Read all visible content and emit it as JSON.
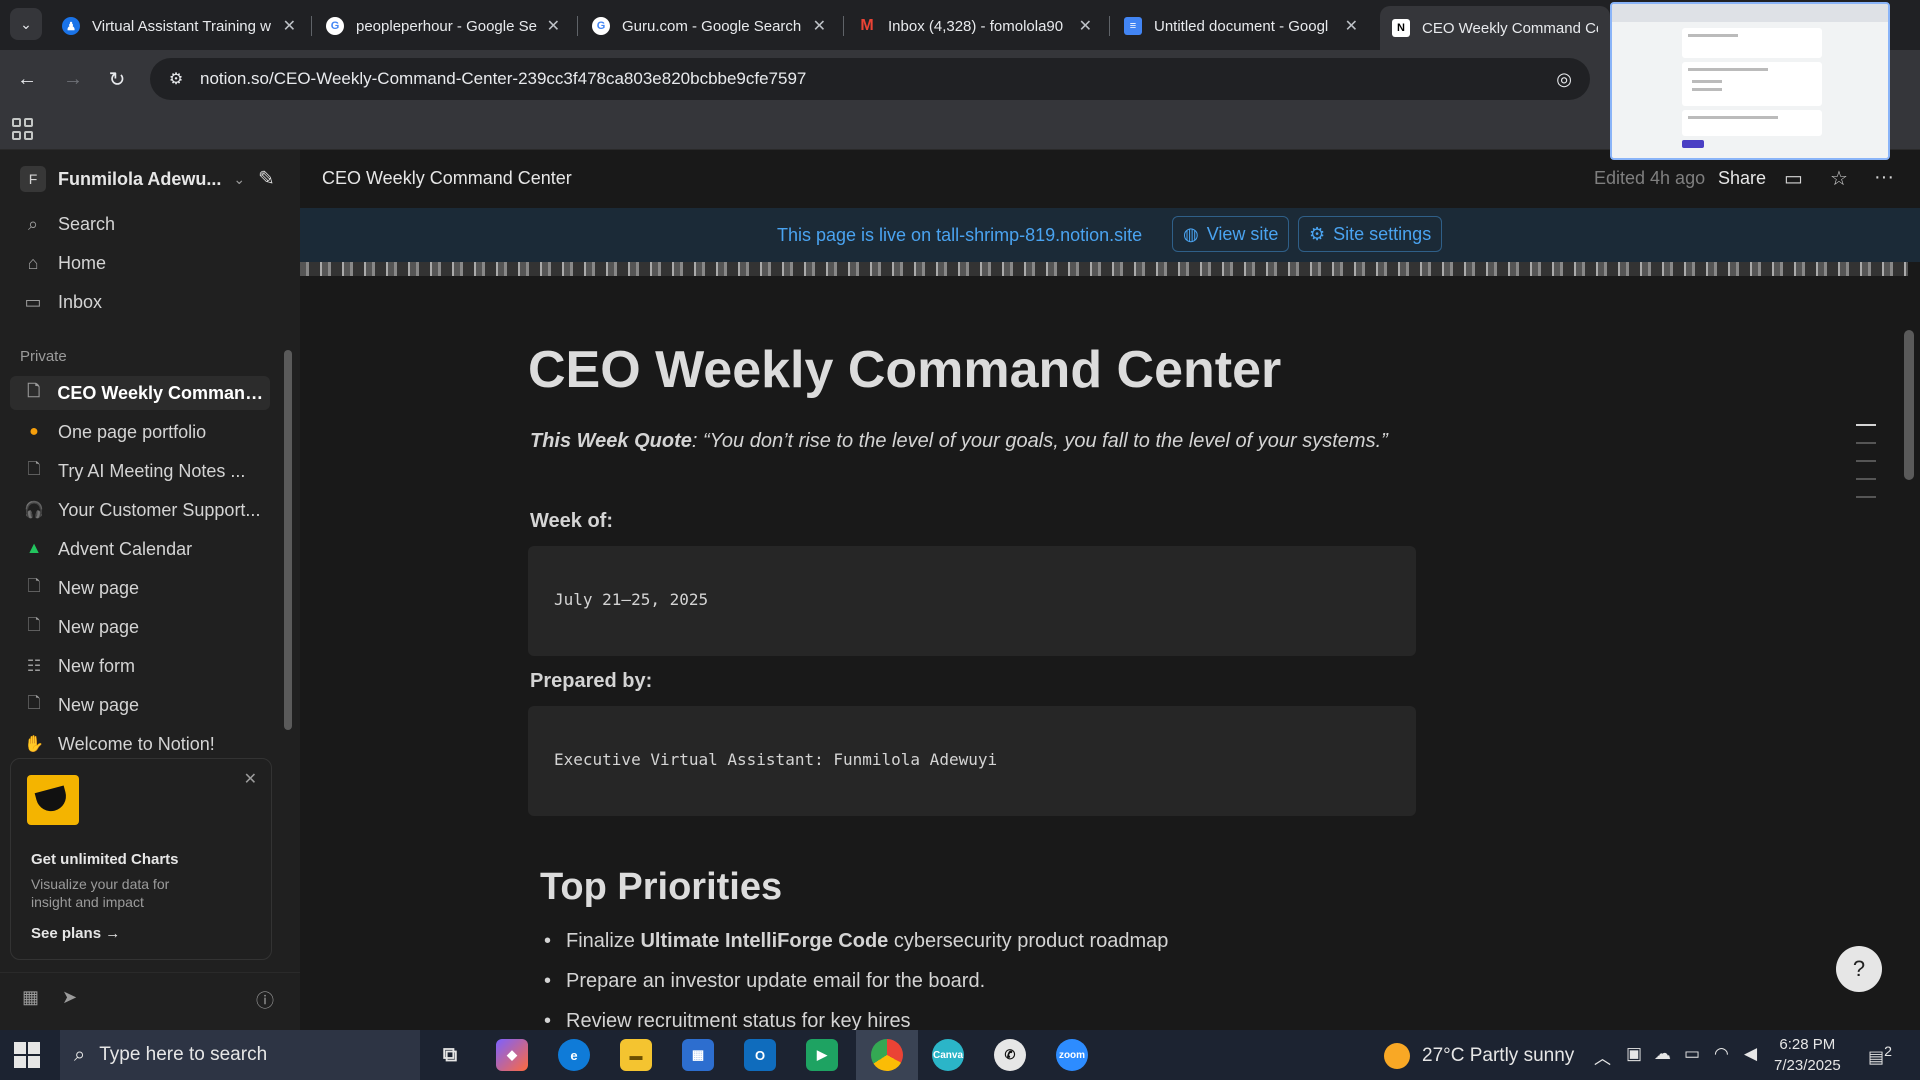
{
  "browser": {
    "tabs": [
      {
        "title": "Virtual Assistant Training w",
        "favicon": "va-icon"
      },
      {
        "title": "peopleperhour - Google Se",
        "favicon": "google-icon"
      },
      {
        "title": "Guru.com - Google Search",
        "favicon": "google-icon"
      },
      {
        "title": "Inbox (4,328) - fomolola90",
        "favicon": "gmail-icon"
      },
      {
        "title": "Untitled document - Googl",
        "favicon": "docs-icon"
      },
      {
        "title": "CEO Weekly Command Ce",
        "favicon": "notion-icon"
      }
    ],
    "url": "notion.so/CEO-Weekly-Command-Center-239cc3f478ca803e820bcbbe9cfe7597"
  },
  "sidebar": {
    "workspace_initial": "F",
    "workspace_name": "Funmilola Adewu...",
    "nav": [
      {
        "label": "Search",
        "icon": "search-icon"
      },
      {
        "label": "Home",
        "icon": "home-icon"
      },
      {
        "label": "Inbox",
        "icon": "inbox-icon"
      }
    ],
    "section_label": "Private",
    "pages": [
      {
        "label": "CEO Weekly Command ...",
        "icon": "page-icon",
        "active": true
      },
      {
        "label": "One page portfolio",
        "icon": "portfolio-icon"
      },
      {
        "label": "Try AI Meeting Notes ...",
        "icon": "page-icon"
      },
      {
        "label": "Your Customer Support...",
        "icon": "headset-icon"
      },
      {
        "label": "Advent Calendar",
        "icon": "tree-icon"
      },
      {
        "label": "New page",
        "icon": "page-icon"
      },
      {
        "label": "New page",
        "icon": "page-icon"
      },
      {
        "label": "New form",
        "icon": "form-icon"
      },
      {
        "label": "New page",
        "icon": "page-icon"
      },
      {
        "label": "Welcome to Notion!",
        "icon": "wave-icon"
      }
    ],
    "promo": {
      "heading": "Get unlimited Charts",
      "description": "Visualize your data for insight and impact",
      "cta": "See plans"
    }
  },
  "topbar": {
    "breadcrumb": "CEO Weekly Command Center",
    "edited": "Edited 4h ago",
    "share": "Share"
  },
  "banner": {
    "text": "This page is live on tall-shrimp-819.notion.site",
    "view_site": "View site",
    "site_settings": "Site settings"
  },
  "doc": {
    "title": "CEO Weekly Command Center",
    "quote_label": "This Week Quote",
    "quote_text": ": “You don’t rise to the level of your goals, you fall to the level of your systems.”",
    "week_label": "Week of:",
    "week_value": "July 21–25, 2025",
    "prepared_label": "Prepared by:",
    "prepared_value": "Executive Virtual Assistant: Funmilola Adewuyi",
    "section_heading": "Top Priorities",
    "priorities": [
      {
        "pre": "Finalize ",
        "bold": "Ultimate IntelliForge Code",
        "post": " cybersecurity product roadmap"
      },
      {
        "pre": "Prepare an investor update email for the board.",
        "bold": "",
        "post": ""
      },
      {
        "pre": "Review recruitment status for key hires",
        "bold": "",
        "post": ""
      }
    ]
  },
  "taskbar": {
    "search_placeholder": "Type here to search",
    "weather": "27°C  Partly sunny",
    "time": "6:28 PM",
    "date": "7/23/2025",
    "notification_count": "2"
  }
}
